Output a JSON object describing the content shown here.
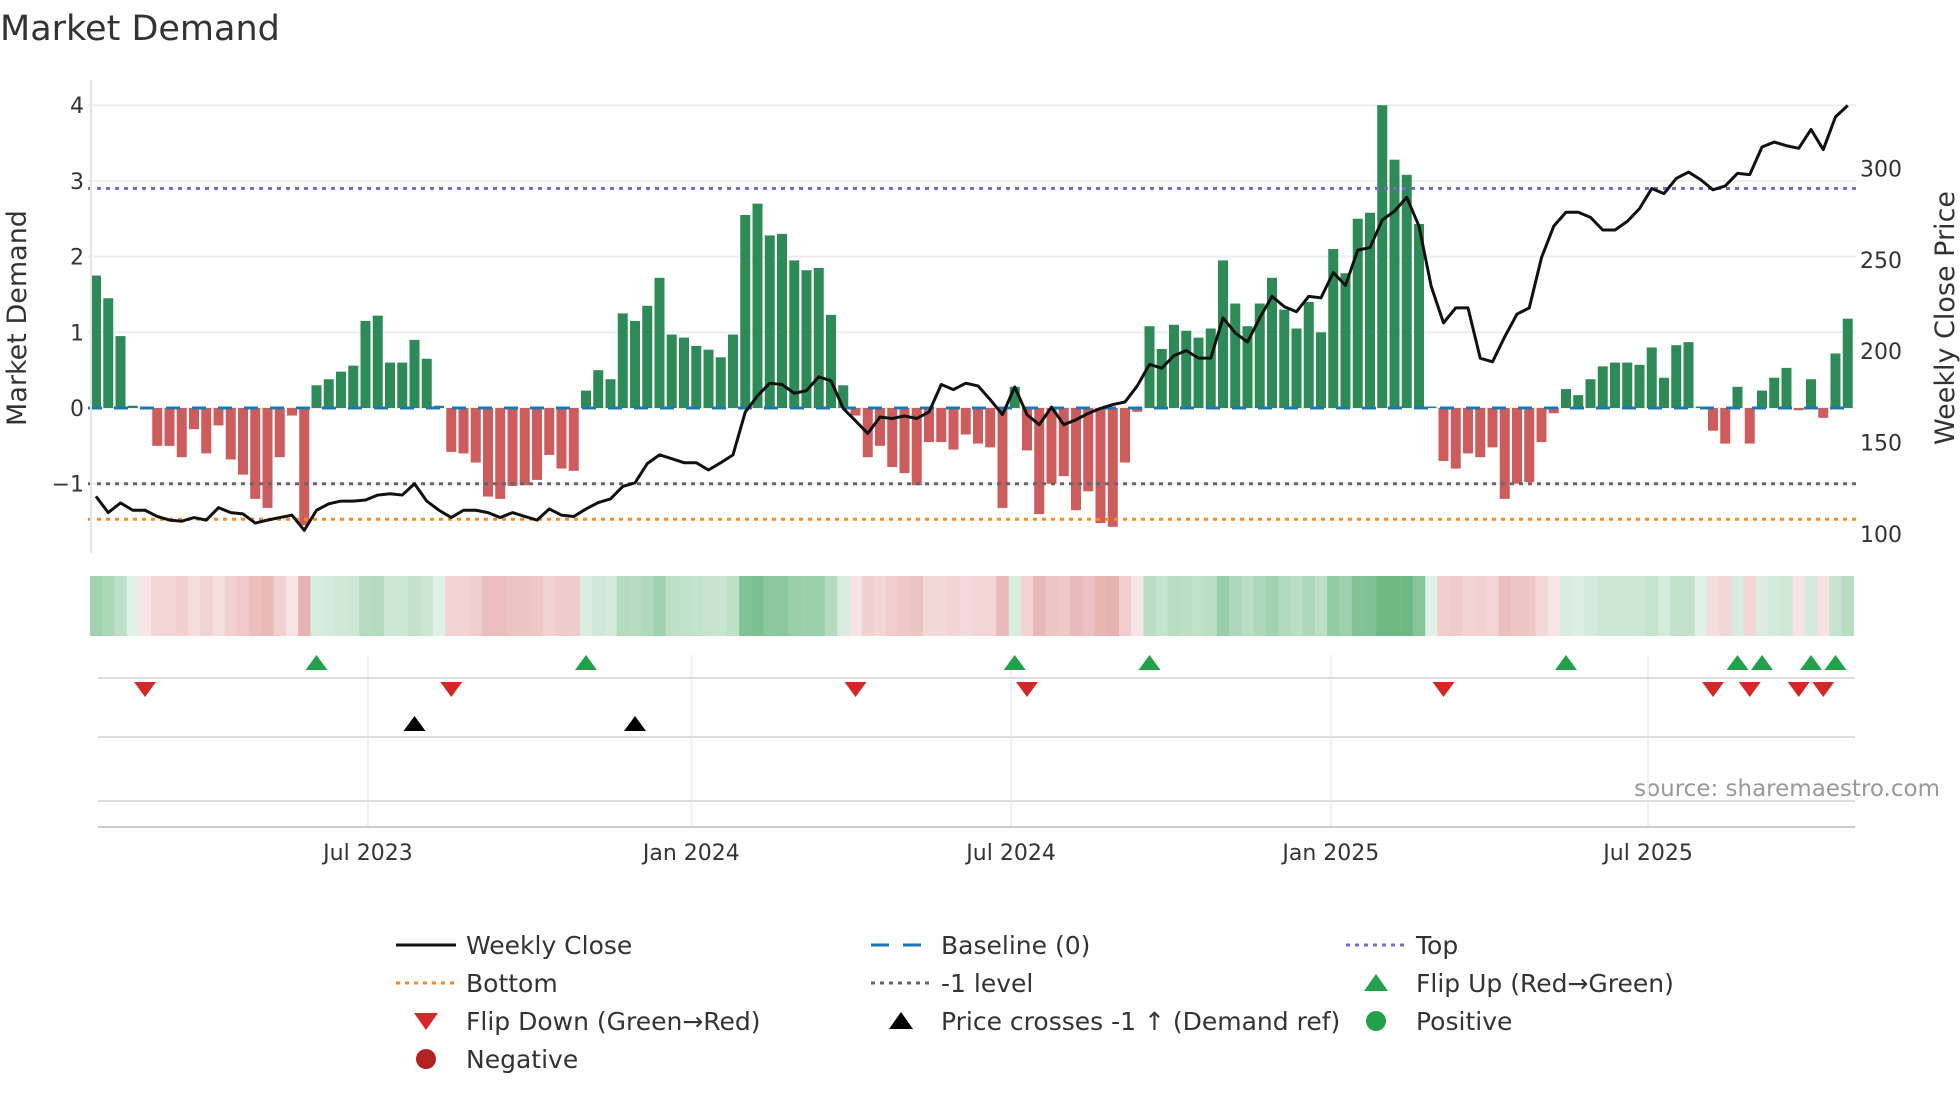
{
  "chart_data": {
    "type": "bar",
    "title": "Market Demand",
    "ylabel": "Market Demand",
    "y2label": "Weekly Close Price",
    "ylim": [
      -1.6,
      4.0
    ],
    "y2lim": [
      100,
      335
    ],
    "yticks": [
      {
        "v": 4,
        "label": "4"
      },
      {
        "v": 3,
        "label": "3"
      },
      {
        "v": 2,
        "label": "2"
      },
      {
        "v": 1,
        "label": "1"
      },
      {
        "v": 0,
        "label": "0"
      },
      {
        "v": -1,
        "label": "−1"
      }
    ],
    "y2ticks": [
      {
        "v": 100,
        "label": "100"
      },
      {
        "v": 150,
        "label": "150"
      },
      {
        "v": 200,
        "label": "200"
      },
      {
        "v": 250,
        "label": "250"
      },
      {
        "v": 300,
        "label": "300"
      }
    ],
    "xticks": [
      {
        "x": 22.2,
        "label": "Jul 2023"
      },
      {
        "x": 48.6,
        "label": "Jan 2024"
      },
      {
        "x": 74.7,
        "label": "Jul 2024"
      },
      {
        "x": 100.8,
        "label": "Jan 2025"
      },
      {
        "x": 126.7,
        "label": "Jul 2025"
      }
    ],
    "frequency": "weekly",
    "top_level": 2.9,
    "bottom_level": -1.47,
    "minus_one_level": -1,
    "demand": [
      1.75,
      1.45,
      0.95,
      0.03,
      -0.02,
      -0.5,
      -0.5,
      -0.65,
      -0.28,
      -0.6,
      -0.23,
      -0.68,
      -0.88,
      -1.2,
      -1.32,
      -0.65,
      -0.1,
      -1.55,
      0.3,
      0.38,
      0.48,
      0.56,
      1.15,
      1.22,
      0.6,
      0.6,
      0.9,
      0.65,
      0.03,
      -0.58,
      -0.6,
      -0.72,
      -1.17,
      -1.2,
      -1.03,
      -1.02,
      -0.95,
      -0.62,
      -0.8,
      -0.83,
      0.23,
      0.5,
      0.38,
      1.25,
      1.15,
      1.35,
      1.72,
      0.97,
      0.93,
      0.82,
      0.77,
      0.67,
      0.97,
      2.55,
      2.7,
      2.28,
      2.3,
      1.95,
      1.82,
      1.85,
      1.23,
      0.3,
      -0.1,
      -0.65,
      -0.5,
      -0.78,
      -0.86,
      -1.02,
      -0.45,
      -0.45,
      -0.55,
      -0.35,
      -0.47,
      -0.52,
      -1.32,
      0.28,
      -0.56,
      -1.4,
      -1.0,
      -0.9,
      -1.35,
      -1.1,
      -1.52,
      -1.57,
      -0.72,
      -0.05,
      1.08,
      0.78,
      1.1,
      1.02,
      0.93,
      1.05,
      1.95,
      1.38,
      1.08,
      1.38,
      1.72,
      1.3,
      1.05,
      1.4,
      1.0,
      2.1,
      1.78,
      2.5,
      2.58,
      4.0,
      3.28,
      3.08,
      2.43,
      0.02,
      -0.7,
      -0.8,
      -0.6,
      -0.65,
      -0.52,
      -1.2,
      -1.0,
      -0.98,
      -0.45,
      -0.07,
      0.25,
      0.17,
      0.38,
      0.55,
      0.6,
      0.6,
      0.57,
      0.8,
      0.4,
      0.83,
      0.87,
      0.02,
      -0.3,
      -0.47,
      0.28,
      -0.47,
      0.23,
      0.4,
      0.53,
      -0.03,
      0.38,
      -0.13,
      0.72,
      1.18
    ],
    "weekly_close": [
      120.6,
      111.7,
      117,
      113,
      113,
      109.6,
      107.6,
      107,
      109,
      107.6,
      114.4,
      111.7,
      111,
      106,
      107.6,
      109,
      110.3,
      102,
      113,
      116.5,
      118,
      118,
      118.6,
      121.3,
      122,
      121.3,
      127.5,
      118,
      113,
      109,
      113,
      113,
      111.7,
      109,
      111.7,
      109.6,
      107.6,
      113.7,
      110.3,
      109.6,
      113.7,
      117.2,
      119.2,
      126,
      128,
      138.5,
      143.3,
      141.2,
      139,
      139,
      135,
      139,
      143.3,
      166.7,
      175.6,
      182.5,
      181.8,
      177,
      178.4,
      186,
      183.8,
      168.7,
      161.9,
      155,
      164,
      163.2,
      164.6,
      163.2,
      166.7,
      181.8,
      179,
      182.5,
      181,
      173.5,
      165.3,
      180.4,
      165.3,
      159.8,
      169.4,
      159.8,
      162.5,
      166,
      168.7,
      170.8,
      172.2,
      181,
      192.8,
      190.7,
      197.6,
      200.3,
      196.2,
      196.2,
      218.2,
      210,
      205,
      218.2,
      230,
      224.4,
      221.6,
      230,
      229.2,
      243,
      236,
      255.3,
      256.7,
      271.8,
      276.6,
      284.2,
      268.4,
      235.4,
      215.5,
      223.7,
      223.7,
      196.2,
      194.2,
      207.9,
      220.3,
      223.7,
      251.2,
      268.4,
      276,
      276,
      273.2,
      266.3,
      266.3,
      271,
      278,
      289,
      286.2,
      294.5,
      298,
      293.8,
      288.3,
      290.4,
      297.3,
      296.6,
      311.7,
      314.4,
      312.4,
      311,
      321.3,
      310.3,
      328.2,
      334.4
    ],
    "price_cross_events": [
      26,
      44
    ],
    "legend": {
      "position": "bottom",
      "items": [
        {
          "label": "Weekly Close",
          "kind": "line",
          "color": "#111111"
        },
        {
          "label": "Baseline (0)",
          "kind": "dash",
          "color": "#1f77b4"
        },
        {
          "label": "Top",
          "kind": "dot",
          "color": "#7b68d6"
        },
        {
          "label": "Bottom",
          "kind": "dot",
          "color": "#ff8c1a"
        },
        {
          "label": "-1 level",
          "kind": "dot",
          "color": "#666666"
        },
        {
          "label": "Flip Up (Red→Green)",
          "kind": "tri-up",
          "color": "#22a04a"
        },
        {
          "label": "Flip Down (Green→Red)",
          "kind": "tri-down",
          "color": "#d62728"
        },
        {
          "label": "Price crosses -1 ↑ (Demand ref)",
          "kind": "tri-up",
          "color": "#000000"
        },
        {
          "label": "Positive",
          "kind": "circle",
          "color": "#22a04a"
        },
        {
          "label": "Negative",
          "kind": "circle",
          "color": "#b22222"
        }
      ]
    },
    "colors": {
      "positive": "#2e8b57",
      "negative": "#cd5c5c",
      "baseline": "#1f77b4"
    }
  },
  "source": "source: sharemaestro.com"
}
